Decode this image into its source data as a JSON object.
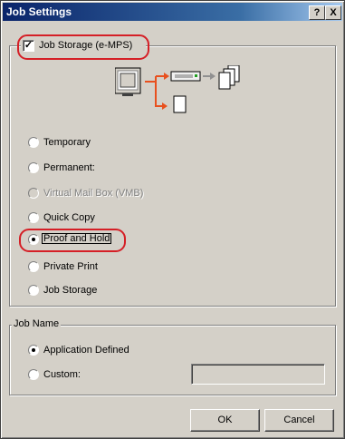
{
  "window": {
    "title": "Job Settings",
    "help_label": "?",
    "close_label": "X"
  },
  "job_storage_group": {
    "checkbox_label": "Job Storage (e-MPS)",
    "checked": true,
    "diagram_icons": [
      "computer-icon",
      "printer-icon",
      "arrow-icon",
      "stacked-pages-icon",
      "single-page-icon"
    ],
    "options": [
      {
        "label": "Temporary",
        "selected": false,
        "enabled": true
      },
      {
        "label": "Permanent:",
        "selected": false,
        "enabled": true
      },
      {
        "label": "Virtual Mail Box (VMB)",
        "selected": false,
        "enabled": false
      },
      {
        "label": "Quick Copy",
        "selected": false,
        "enabled": true
      },
      {
        "label": "Proof and Hold",
        "selected": true,
        "enabled": true
      },
      {
        "label": "Private Print",
        "selected": false,
        "enabled": true
      },
      {
        "label": "Job Storage",
        "selected": false,
        "enabled": true
      }
    ]
  },
  "job_name_group": {
    "title": "Job Name",
    "options": [
      {
        "label": "Application Defined",
        "selected": true
      },
      {
        "label": "Custom:",
        "selected": false
      }
    ],
    "custom_value": ""
  },
  "buttons": {
    "ok_label": "OK",
    "cancel_label": "Cancel"
  },
  "colors": {
    "highlight": "#d51f26",
    "connector": "#e8501e",
    "titlebar": "#0a246a"
  }
}
